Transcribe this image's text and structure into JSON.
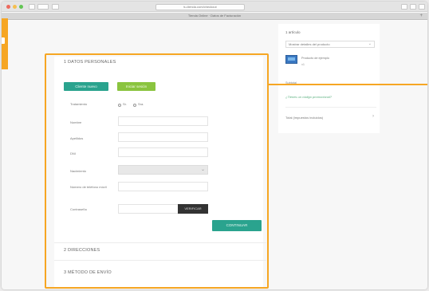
{
  "browser": {
    "url": "tu-tienda.com/checkout",
    "tab_title": "Tienda Online · Datos de Facturación",
    "new_tab": "+"
  },
  "checkout": {
    "section1_title": "1   DATOS PERSONALES",
    "btn_new_customer": "Cliente nuevo",
    "btn_login": "Iniciar sesión",
    "treatment_label": "Tratamiento",
    "treatment_options": [
      "Sr.",
      "Sra."
    ],
    "name_label": "Nombre",
    "surname_label": "Apellidos",
    "dni_label": "DNI",
    "birth_label": "Nacimiento",
    "phone_label": "Número de teléfono móvil",
    "code_label": "Contraseña",
    "verify_button": "VERIFICAR",
    "continue_button": "CONTINUAR",
    "section2_title": "2   DIRECCIONES",
    "section3_title": "3   MÉTODO DE ENVÍO"
  },
  "summary": {
    "title": "1 artículo",
    "select_value": "Mostrar detalles del producto",
    "product_name": "Producto de ejemplo",
    "product_qty": "x1",
    "subtotal_label": "Subtotal",
    "promo_link": "¿Tienes un código promocional?",
    "total_label": "Total (impuestos incluidos)"
  }
}
